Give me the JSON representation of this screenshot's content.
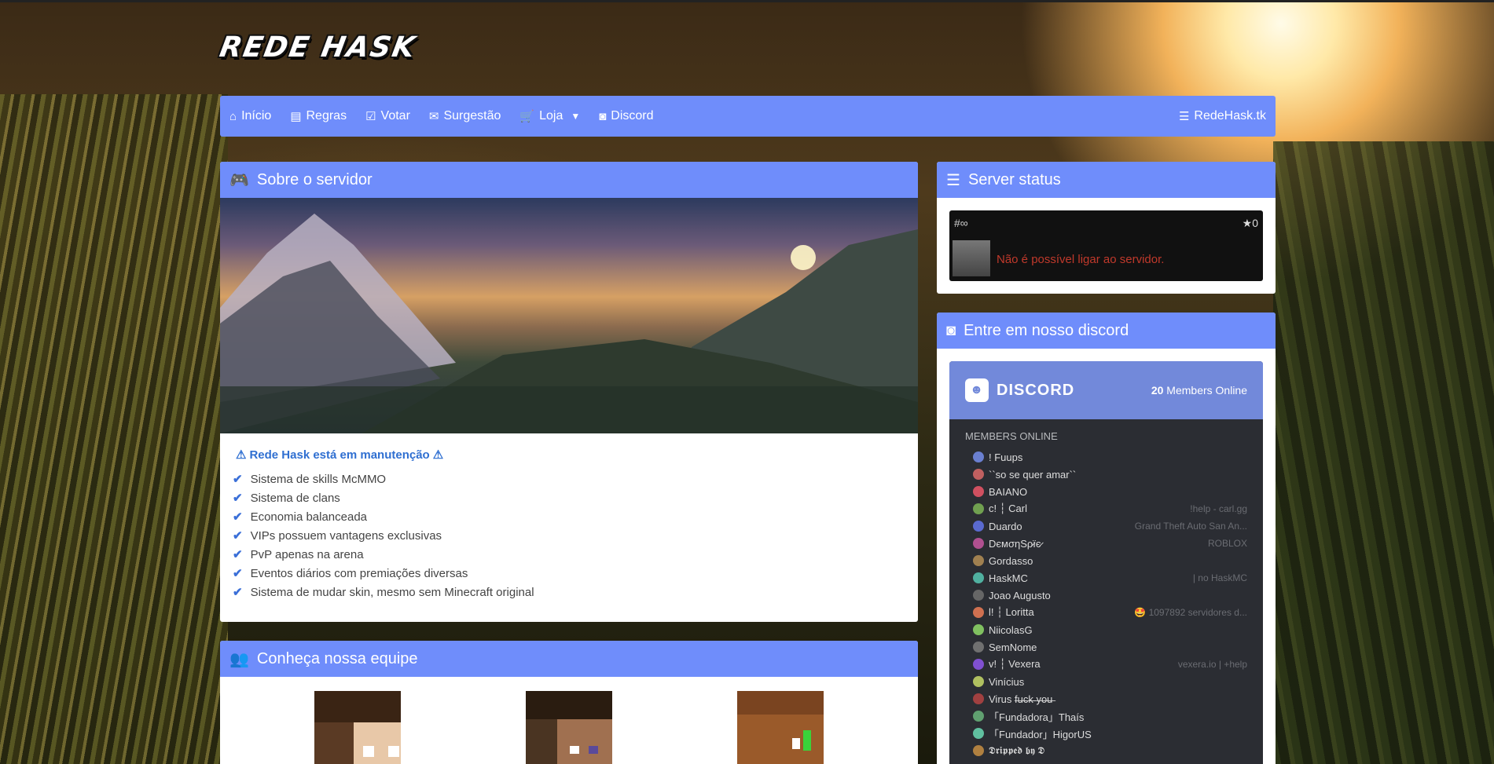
{
  "brand": {
    "logo_text": "REDE HASK"
  },
  "nav": {
    "items": [
      {
        "label": "Início",
        "icon": "home-icon"
      },
      {
        "label": "Regras",
        "icon": "book-icon"
      },
      {
        "label": "Votar",
        "icon": "vote-icon"
      },
      {
        "label": "Surgestão",
        "icon": "envelope-icon"
      },
      {
        "label": "Loja",
        "icon": "cart-icon"
      },
      {
        "label": "Discord",
        "icon": "discord-icon"
      }
    ],
    "right_label": "RedeHask.tk"
  },
  "about": {
    "title": "Sobre o servidor",
    "alert": "Rede Hask está em manutenção",
    "features": [
      "Sistema de skills McMMO",
      "Sistema de clans",
      "Economia balanceada",
      "VIPs possuem vantagens exclusivas",
      "PvP apenas na arena",
      "Eventos diários com premiações diversas",
      "Sistema de mudar skin, mesmo sem Minecraft original"
    ]
  },
  "team": {
    "title": "Conheça nossa equipe"
  },
  "status": {
    "title": "Server status",
    "rank": "#∞",
    "stars": "★0",
    "message": "Não é possível ligar ao servidor."
  },
  "discord": {
    "title": "Entre em nosso discord",
    "brand": "DISCORD",
    "count": "20",
    "count_label": "Members Online",
    "members_heading": "MEMBERS ONLINE",
    "members": [
      {
        "name": "! Fuups",
        "game": ""
      },
      {
        "name": "``so se quer amar``",
        "game": ""
      },
      {
        "name": "BAIANO",
        "game": ""
      },
      {
        "name": "c! ┆ Carl",
        "game": "!help - carl.gg"
      },
      {
        "name": "Duardo",
        "game": "Grand Theft Auto San An..."
      },
      {
        "name": "DємσηЅρ̷їє̷",
        "game": "ROBLOX"
      },
      {
        "name": "Gordasso",
        "game": ""
      },
      {
        "name": "HaskMC",
        "game": "| no HaskMC"
      },
      {
        "name": "Joao Augusto",
        "game": ""
      },
      {
        "name": "l! ┆ Loritta",
        "game": "🤩 1097892 servidores d..."
      },
      {
        "name": "NiicolasG",
        "game": ""
      },
      {
        "name": "SemNome",
        "game": ""
      },
      {
        "name": "v! ┆ Vexera",
        "game": "vexera.io | +help"
      },
      {
        "name": "Vinícius",
        "game": ""
      },
      {
        "name": "Virus f̶u̶c̶k̶ ̶y̶o̶u̶",
        "game": ""
      },
      {
        "name": "「Fundadora」Thaís",
        "game": ""
      },
      {
        "name": "「Fundador」HigorUS",
        "game": ""
      },
      {
        "name": "𝕯𝖗𝖎𝖕𝖕𝖊𝖉 𝖇𝖞 𝕯",
        "game": ""
      }
    ]
  },
  "colors": {
    "accent": "#6f8dfb",
    "alert_blue": "#2f6fd1",
    "error_red": "#c0392b",
    "discord": "#7289da"
  }
}
